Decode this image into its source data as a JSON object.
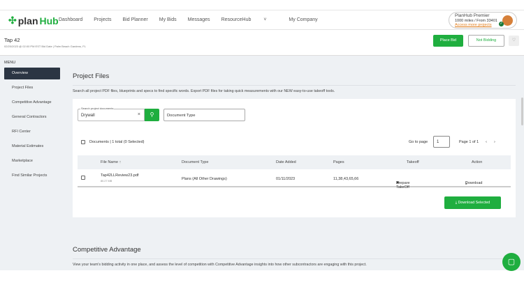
{
  "header": {
    "logo_plan": "plan",
    "logo_hub": "Hub",
    "nav": [
      "Dashboard",
      "Projects",
      "Bid Planner",
      "My Bids",
      "Messages",
      "ResourceHub",
      "My Company"
    ],
    "plan": {
      "title": "PlanHub Premier",
      "detail": "1000 miles / From 33401",
      "link": "Access more projects"
    }
  },
  "project": {
    "title": "Tap 42",
    "subtitle": "02/20/2023 @ 02:00 PM EST Bid Date | Palm Beach Gardens, FL",
    "place_bid": "Place Bid",
    "not_bidding": "Not Bidding"
  },
  "sidebar": {
    "label": "MENU",
    "items": [
      "Overview",
      "Project Files",
      "Competitive Advantage",
      "General Contractors",
      "RFI Center",
      "Material Estimates",
      "Marketplace",
      "Find Similar Projects"
    ]
  },
  "files": {
    "title": "Project Files",
    "description": "Search all project PDF files, blueprints and specs to find specific words. Export PDF files for taking quick measurements with our NEW easy-to-use takeoff tools.",
    "search_label": "Search project documents",
    "search_value": "Drywall",
    "doc_type_placeholder": "Document Type",
    "count": "Documents | 1 total (0 Selected)",
    "goto_label": "Go to page",
    "goto_value": "1",
    "page_info": "Page 1 of 1",
    "columns": [
      "File Name ↑",
      "Document Type",
      "Date Added",
      "Pages",
      "Takeoff",
      "Action"
    ],
    "rows": [
      {
        "name": "Tap42LLReview23.pdf",
        "size": "80.27 MB",
        "type": "Plans (All Other Drawings)",
        "date": "01/11/2023",
        "pages": "11,38,43,65,66",
        "takeoff": "Prepare TakeOff",
        "action": "Download"
      }
    ],
    "download_selected": "Download Selected"
  },
  "competitive": {
    "title": "Competitive Advantage",
    "description": "View your team's bidding activity in one place, and assess the level of competition with Competitive Advantage insights into how other subcontractors are engaging with this project."
  },
  "colors": {
    "accent": "#1fae3f",
    "sidebar_active": "#2b3543",
    "link": "#e07b18"
  }
}
